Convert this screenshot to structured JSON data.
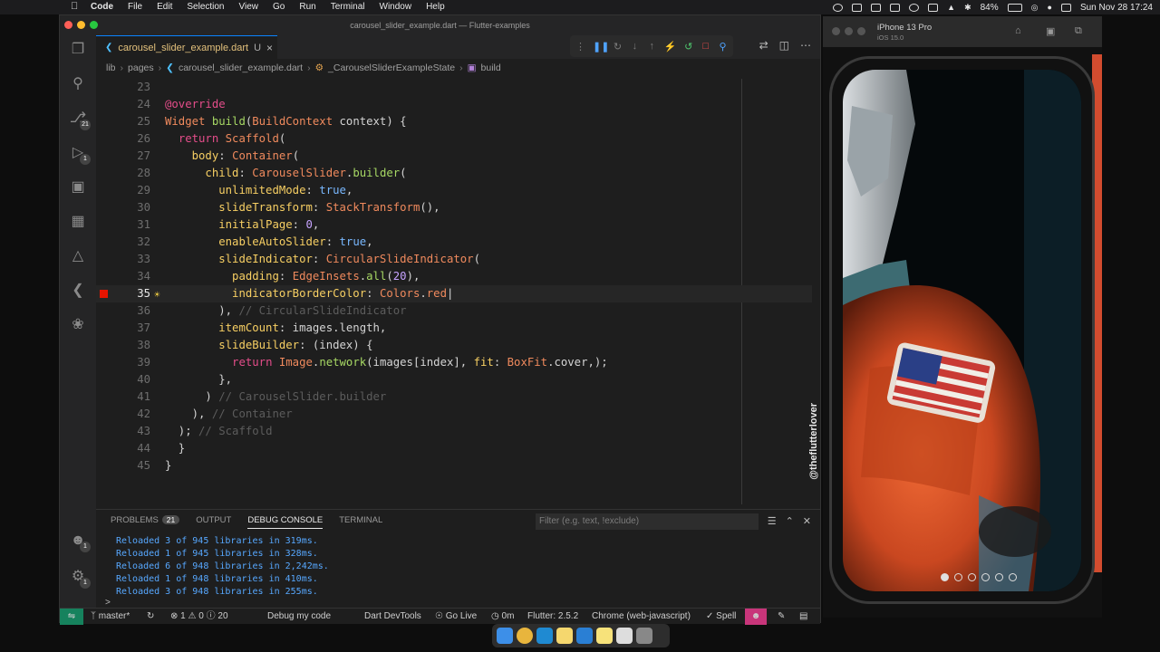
{
  "menubar": {
    "apple": "",
    "items": [
      "Code",
      "File",
      "Edit",
      "Selection",
      "View",
      "Go",
      "Run",
      "Terminal",
      "Window",
      "Help"
    ],
    "battery": "84%",
    "datetime": "Sun Nov 28  17:24"
  },
  "window": {
    "title": "carousel_slider_example.dart — Flutter-examples"
  },
  "activity_bar": {
    "source_control_badge": "21",
    "run_badge": "1",
    "accounts_badge": "1",
    "settings_badge": "1"
  },
  "tab": {
    "filename": "carousel_slider_example.dart",
    "status": "U",
    "close": "×"
  },
  "breadcrumb": [
    "lib",
    "pages",
    "carousel_slider_example.dart",
    "_CarouselSliderExampleState",
    "build"
  ],
  "code": {
    "line_numbers": [
      "23",
      "24",
      "25",
      "26",
      "27",
      "28",
      "29",
      "30",
      "31",
      "32",
      "33",
      "34",
      "35",
      "36",
      "37",
      "38",
      "39",
      "40",
      "41",
      "42",
      "43",
      "44",
      "45"
    ],
    "active_line": "35"
  },
  "panel": {
    "tabs": [
      "PROBLEMS",
      "OUTPUT",
      "DEBUG CONSOLE",
      "TERMINAL"
    ],
    "problems_count": "21",
    "filter_placeholder": "Filter (e.g. text, !exclude)",
    "console_lines": [
      "Reloaded 3 of 945 libraries in 319ms.",
      "Reloaded 1 of 945 libraries in 328ms.",
      "Reloaded 6 of 948 libraries in 2,242ms.",
      "Reloaded 1 of 948 libraries in 410ms.",
      "Reloaded 3 of 948 libraries in 255ms."
    ],
    "prompt": ">"
  },
  "statusbar": {
    "branch": "master*",
    "errors": "1",
    "warnings": "0",
    "infos": "20",
    "debug": "Debug my code",
    "devtools": "Dart DevTools",
    "golive": "Go Live",
    "timer": "0m",
    "flutter": "Flutter: 2.5.2",
    "device": "Chrome (web-javascript)",
    "spell": "Spell"
  },
  "simulator": {
    "device_name": "iPhone 13 Pro",
    "os": "iOS 15.0",
    "watermark": "@theflutterlover"
  },
  "colors": {
    "accent_blue": "#0a84ff",
    "breakpoint": "#e51400",
    "console_text": "#57a8ff",
    "suit_orange": "#e0552b"
  }
}
